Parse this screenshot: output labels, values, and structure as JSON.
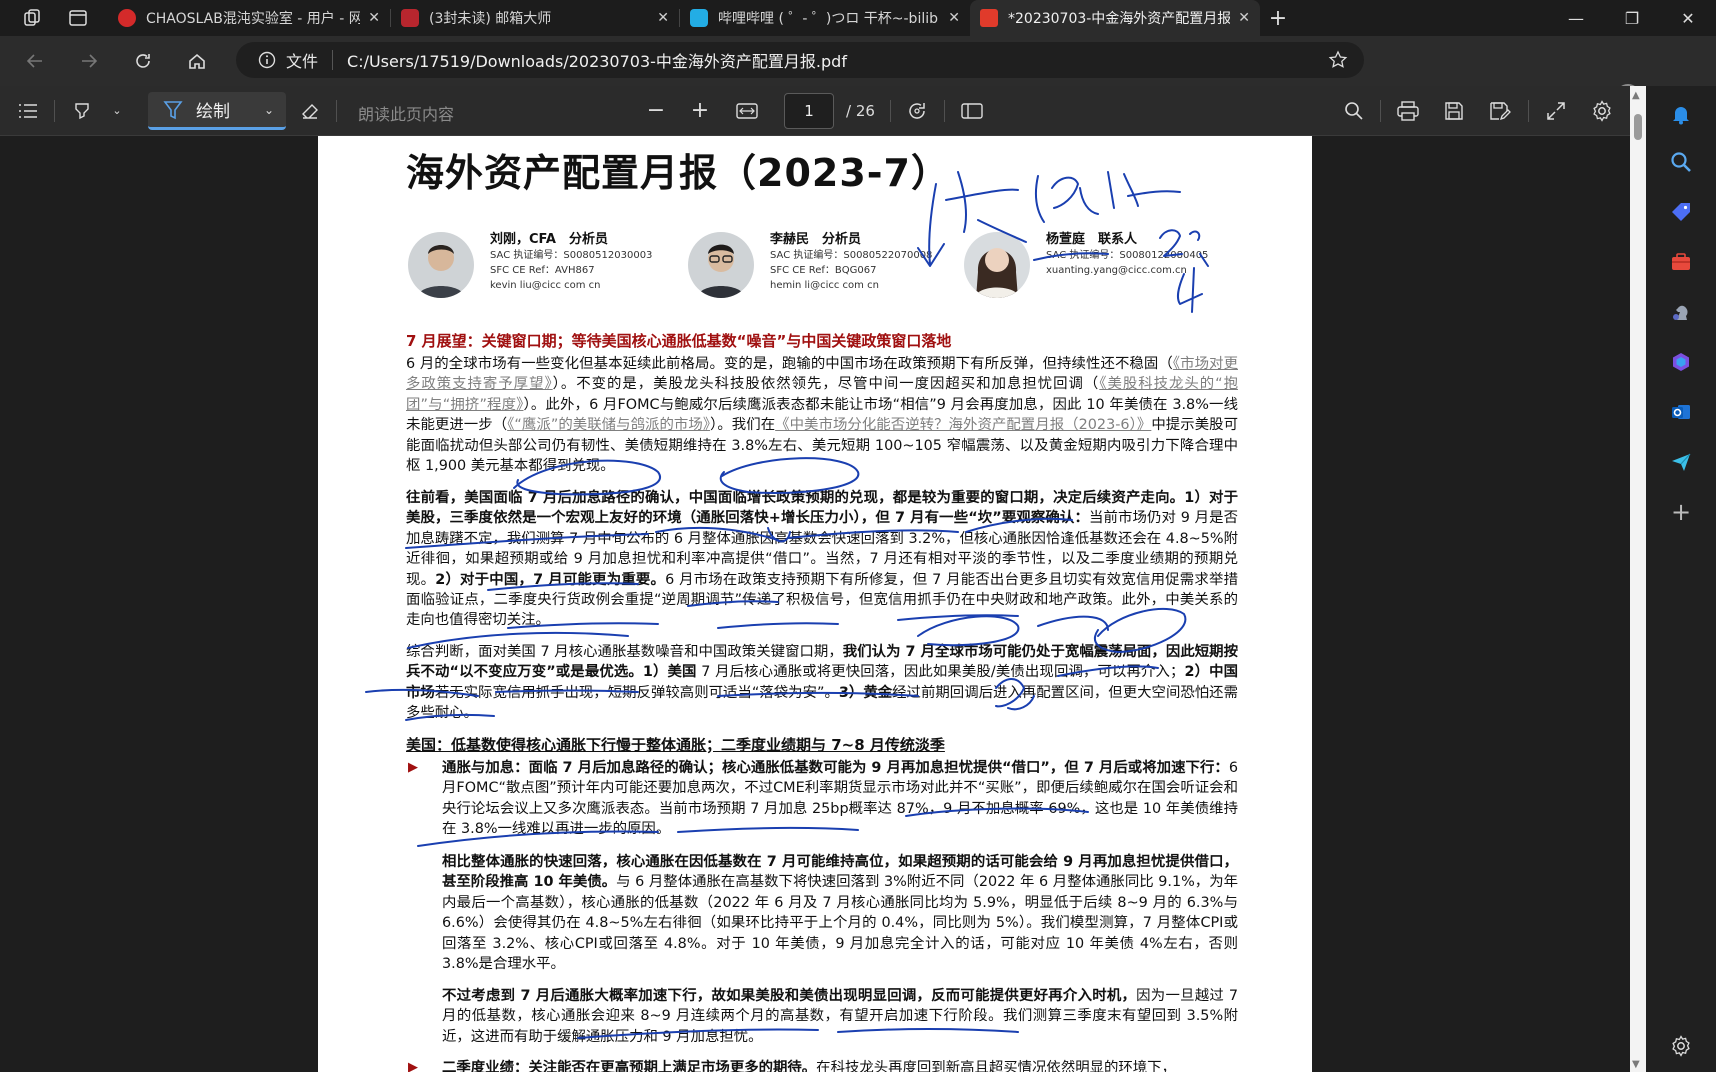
{
  "browser": {
    "tabs": [
      {
        "title": "CHAOSLAB混沌实验室 - 用户 - 网",
        "color": "#d42a2a"
      },
      {
        "title": "(3封未读) 邮箱大师",
        "color": "#b8262e"
      },
      {
        "title": "哔哩哔哩 ( ゜- ゜)つロ 干杯~-bilib",
        "color": "#23ade5"
      },
      {
        "title": "*20230703-中金海外资产配置月报",
        "color": "#e03b2b"
      }
    ],
    "address_label": "文件",
    "url": "C:/Users/17519/Downloads/20230703-中金海外资产配置月报.pdf"
  },
  "pdf_toolbar": {
    "draw_label": "绘制",
    "read_aloud": "朗读此页内容",
    "page_current": "1",
    "page_total": "/ 26"
  },
  "doc": {
    "title": "海外资产配置月报（2023-7）",
    "authors": [
      {
        "name": "刘刚，CFA　分析员",
        "lines": [
          "SAC 执证编号：S0080512030003",
          "SFC CE Ref：AVH867",
          "kevin liu@cicc com cn"
        ]
      },
      {
        "name": "李赫民　分析员",
        "lines": [
          "SAC 执证编号：S0080522070008",
          "SFC CE Ref：BQG067",
          "hemin li@cicc com cn"
        ]
      },
      {
        "name": "杨萱庭　联系人",
        "lines": [
          "SAC 执证编号：S0080122080405",
          "xuanting.yang@cicc.com.cn"
        ]
      }
    ],
    "s1_title": "7 月展望：关键窗口期；等待美国核心通胀低基数“噪音”与中国关键政策窗口落地",
    "p1_a": "6 月的全球市场有一些变化但基本延续此前格局。变的是，跑输的中国市场在政策预期下有所反弹，但持续性还不稳固（",
    "p1_l1": "《市场对更多政策支持寄予厚望》",
    "p1_b": "）。不变的是，美股龙头科技股依然领先，尽管中间一度因超买和加息担忧回调（",
    "p1_l2": "《美股科技龙头的“抱团”与“拥挤”程度》",
    "p1_c": "）。此外，6 月FOMC与鲍威尔后续鹰派表态都未能让市场“相信”9 月会再度加息，因此 10 年美债在 3.8%一线未能更进一步（",
    "p1_l3": "《“鹰派”的美联储与鸽派的市场》",
    "p1_d": "）。我们在",
    "p1_l4": "《中美市场分化能否逆转？海外资产配置月报（2023-6）》",
    "p1_e": "中提示美股可能面临扰动但头部公司仍有韧性、美债短期维持在 3.8%左右、美元短期 100~105 窄幅震荡、以及黄金短期内吸引力下降合理中枢 1,900 美元基本都得到兑现。",
    "p2_b1": "往前看，美国面临 7 月后加息路径的确认，中国面临增长政策预期的兑现，都是较为重要的窗口期，决定后续资产走向。1）对于美股，三季度依然是一个宏观上友好的环境（通胀回落快+增长压力小），但 7 月有一些“坎”要观察确认：",
    "p2_n1": "当前市场仍对 9 月是否加息踌躇不定，我们测算 7 月中旬公布的 6 月整体通胀因高基数会快速回落到 3.2%，但核心通胀因恰逢低基数还会在 4.8~5%附近徘徊，如果超预期或给 9 月加息担忧和利率冲高提供“借口”。当然，7 月还有相对平淡的季节性，以及二季度业绩期的预期兑现。",
    "p2_b2": "2）对于中国，7 月可能更为重要。",
    "p2_n2": "6 月市场在政策支持预期下有所修复，但 7 月能否出台更多且切实有效宽信用促需求举措面临验证点，二季度央行货政例会重提“逆周期调节”传递了积极信号，但宽信用抓手仍在中央财政和地产政策。此外，中美关系的走向也值得密切关注。",
    "p3_n1": "综合判断，面对美国 7 月核心通胀基数噪音和中国政策关键窗口期，",
    "p3_b1": "我们认为 7 月全球市场可能仍处于宽幅震荡局面，因此短期按兵不动“以不变应万变”或是最优选。",
    "p3_b2": "1）美国",
    "p3_n2": " 7 月后核心通胀或将更快回落，因此如果美股/美债出现回调，可以再介入；",
    "p3_b3": "2）中国市场",
    "p3_n3": "若无实际宽信用抓手出现，短期反弹较高则可适当“落袋为安”。",
    "p3_b4": "3）黄金",
    "p3_n4": "经过前期回调后进入再配置区间，但更大空间恐怕还需多些耐心。",
    "s2_title": "美国：低基数使得核心通胀下行慢于整体通胀；二季度业绩期与 7~8 月传统淡季",
    "b1_bold": "通胀与加息：面临 7 月后加息路径的确认；核心通胀低基数可能为 9 月再加息担忧提供“借口”，但 7 月后或将加速下行：",
    "b1_text": "6 月FOMC“散点图”预计年内可能还要加息两次，不过CME利率期货显示市场对此并不“买账”，即便后续鲍威尔在国会听证会和央行论坛会议上又多次鹰派表态。当前市场预期 7 月加息 25bp概率达 87%，9 月不加息概率 69%，这也是 10 年美债维持在 3.8%一线难以再进一步的原因。",
    "b1p2_bold": "相比整体通胀的快速回落，核心通胀在因低基数在 7 月可能维持高位，如果超预期的话可能会给 9 月再加息担忧提供借口，甚至阶段推高 10 年美债。",
    "b1p2_text": "与 6 月整体通胀在高基数下将快速回落到 3%附近不同（2022 年 6 月整体通胀同比 9.1%，为年内最后一个高基数），核心通胀的低基数（2022 年 6 月及 7 月核心通胀同比均为 5.9%，明显低于后续 8~9 月的 6.3%与 6.6%）会使得其仍在 4.8~5%左右徘徊（如果环比持平于上个月的 0.4%，同比则为 5%）。我们模型测算，7 月整体CPI或回落至 3.2%、核心CPI或回落至 4.8%。对于 10 年美债，9 月加息完全计入的话，可能对应 10 年美债 4%左右，否则 3.8%是合理水平。",
    "b1p3_bold": "不过考虑到 7 月后通胀大概率加速下行，故如果美股和美债出现明显回调，反而可能提供更好再介入时机，",
    "b1p3_text": "因为一旦越过 7 月的低基数，核心通胀会迎来 8~9 月连续两个月的高基数，有望开启加速下行阶段。我们测算三季度末有望回到 3.5%附近，这进而有助于缓解通胀压力和 9 月加息担忧。",
    "b2_bold": "二季度业绩：关注能否在更高预期上满足市场更多的期待。",
    "b2_text": "在科技龙头再度回到新高且超买情况依然明显的环境下，"
  }
}
